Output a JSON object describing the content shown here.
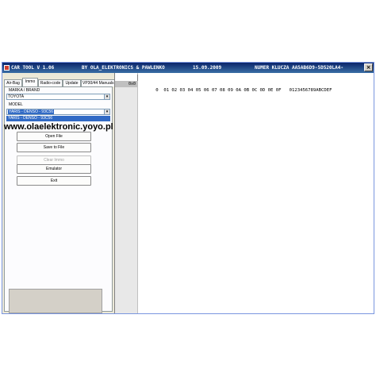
{
  "window": {
    "title_app": "CAR TOOL V 1.06",
    "title_by": "BY OLA_ELEKTRONICS  &  PAWLENKO",
    "title_date": "15.09.2009",
    "title_serial": "NUMER KLUCZA AA5AB6D9-5D520LA4-",
    "close_glyph": "×"
  },
  "tabs": [
    {
      "label": "Air-Bag"
    },
    {
      "label": "Immo"
    },
    {
      "label": "Radio-code"
    },
    {
      "label": "Update"
    },
    {
      "label": "VP30/44 Manuals"
    }
  ],
  "immo": {
    "brand_label": "MARKA / BRAND",
    "brand_value": "TOYOTA",
    "model_label": "MODEL",
    "model_value": "YARIS - DENSO - 93C56",
    "dropdown_option": "YARIS - DENSO - 93C56",
    "arrow_glyph": "▾"
  },
  "watermark": "www.olaelektronic.yoyo.pl",
  "buttons": {
    "open_file": "Open File",
    "save_to_file": "Save to File",
    "clear_immo": "Clear Immo",
    "emulator": "Emulator",
    "exit": "Exit"
  },
  "hex": {
    "header": "0  01 02 03 04 05 06 07 08 09 0A 0B 0C 0D 0E 0F   0123456789ABCDEF",
    "first_address": "0x0"
  },
  "colors": {
    "titlebar": "#0a246a",
    "selection": "#316ac5",
    "window_bg": "#ece9d8"
  }
}
